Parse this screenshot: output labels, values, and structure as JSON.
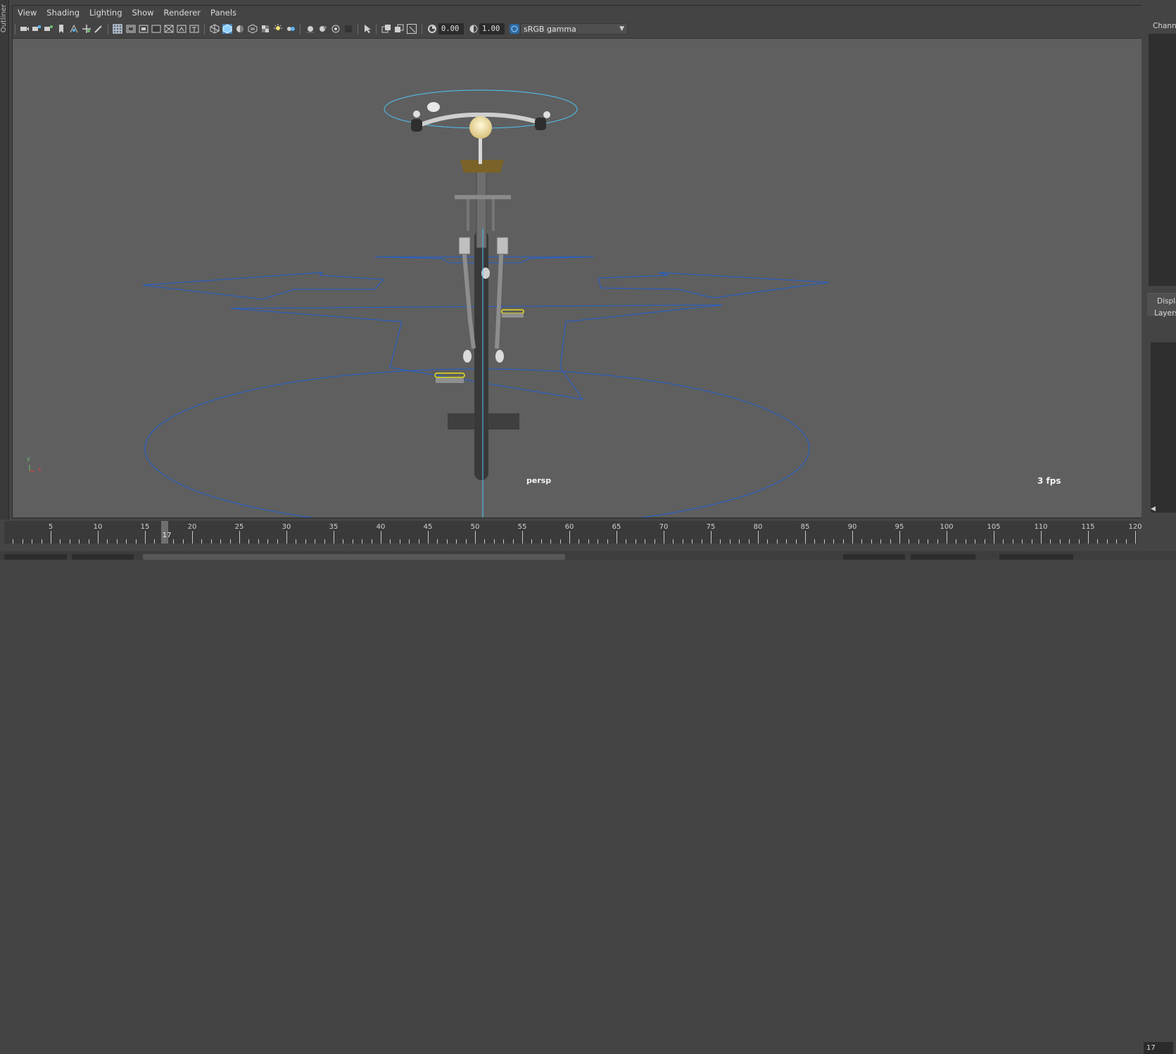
{
  "side_strip": {
    "label": "Outliner"
  },
  "menubar": {
    "items": [
      "View",
      "Shading",
      "Lighting",
      "Show",
      "Renderer",
      "Panels"
    ]
  },
  "toolbar": {
    "exposure_value": "0.00",
    "gamma_value": "1.00",
    "color_space": "sRGB gamma",
    "icons": [
      "select-camera-icon",
      "camera-attributes-icon",
      "bookmark-icon",
      "image-plane-icon",
      "two-d-pan-icon",
      "grease-pencil-icon",
      "grid-icon",
      "film-gate-icon",
      "resolution-gate-icon",
      "gate-mask-icon",
      "field-chart-icon",
      "safe-action-icon",
      "safe-title-icon",
      "wireframe-icon",
      "smooth-shade-icon",
      "default-material-icon",
      "textured-icon",
      "use-all-lights-icon",
      "shadows-icon",
      "screen-space-ao-icon",
      "motion-blur-icon",
      "anti-aliasing-icon",
      "depth-of-field-icon",
      "xray-icon",
      "xray-joints-icon",
      "xray-components-icon",
      "isolate-select-icon",
      "exposure-icon",
      "gamma-icon",
      "color-management-icon"
    ]
  },
  "viewport": {
    "camera_label": "persp",
    "fps_label": "3 fps",
    "axis_y": "y",
    "axis_x": "x"
  },
  "right_panel": {
    "channel_box_label": "Channel",
    "display_tab_label": "Display",
    "layers_label": "Layers"
  },
  "time_slider": {
    "labels": [
      "5",
      "10",
      "15",
      "20",
      "25",
      "30",
      "35",
      "40",
      "45",
      "50",
      "55",
      "60",
      "65",
      "70",
      "75",
      "80",
      "85",
      "90",
      "95",
      "100",
      "105",
      "110",
      "115",
      "120"
    ],
    "current_frame": "17",
    "current_frame_field": "17"
  },
  "colors": {
    "viewport_bg": "#5f5f5f",
    "panel_bg": "#444444",
    "wire_blue": "#1f5fd0",
    "highlight_cyan": "#4fc3f7",
    "selected_yellow": "#e8e21a",
    "toolbar_active": "#5ab1ef"
  }
}
